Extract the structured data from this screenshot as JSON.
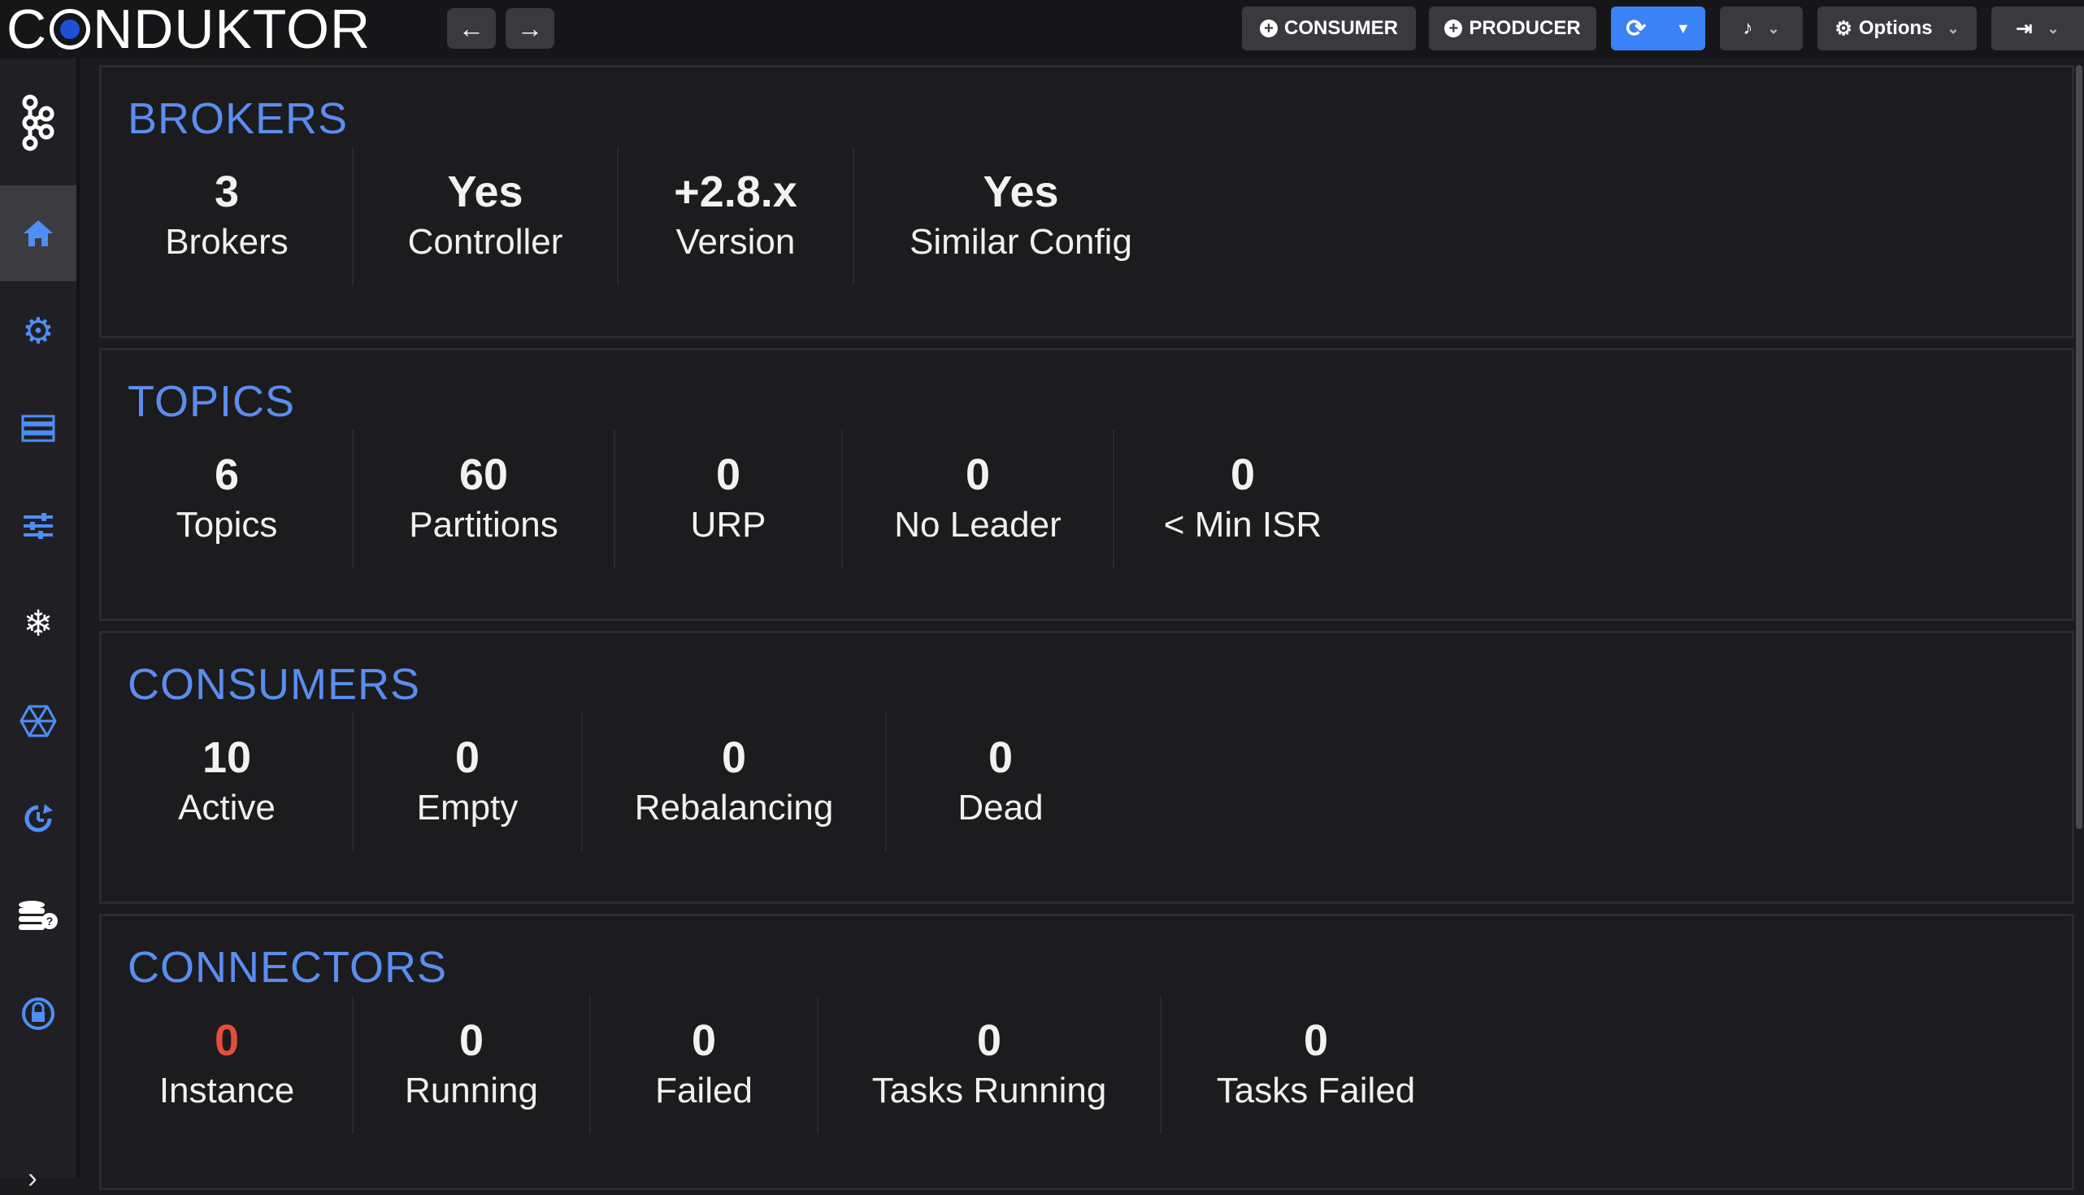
{
  "app": {
    "logo": "CONDUKTOR"
  },
  "toolbar": {
    "back_icon": "←",
    "forward_icon": "→",
    "consumer_label": "CONSUMER",
    "producer_label": "PRODUCER",
    "refresh_icon": "⟳",
    "refresh_dropdown_icon": "▼",
    "bell_icon": "🔔",
    "options_label": "Options",
    "logout_icon": "⇥",
    "chevron": "⌄"
  },
  "sidebar": {
    "items": [
      {
        "name": "cluster-icon",
        "glyph": "⚛"
      },
      {
        "name": "home-icon",
        "glyph": "⌂"
      },
      {
        "name": "brokers-config-icon",
        "glyph": "⚙"
      },
      {
        "name": "topics-icon",
        "glyph": "☰"
      },
      {
        "name": "settings-sliders-icon",
        "glyph": "≡"
      },
      {
        "name": "schema-help-icon",
        "glyph": "❄"
      },
      {
        "name": "connect-icon",
        "glyph": "⬡"
      },
      {
        "name": "history-icon",
        "glyph": "↻"
      },
      {
        "name": "database-help-icon",
        "glyph": "⛁"
      },
      {
        "name": "security-lock-icon",
        "glyph": "🔒"
      }
    ],
    "expand_icon": "›"
  },
  "panels": {
    "brokers": {
      "title": "BROKERS",
      "stats": [
        {
          "value": "3",
          "label": "Brokers"
        },
        {
          "value": "Yes",
          "label": "Controller"
        },
        {
          "value": "+2.8.x",
          "label": "Version"
        },
        {
          "value": "Yes",
          "label": "Similar Config"
        }
      ]
    },
    "topics": {
      "title": "TOPICS",
      "stats": [
        {
          "value": "6",
          "label": "Topics"
        },
        {
          "value": "60",
          "label": "Partitions"
        },
        {
          "value": "0",
          "label": "URP"
        },
        {
          "value": "0",
          "label": "No Leader"
        },
        {
          "value": "0",
          "label": "< Min ISR"
        }
      ]
    },
    "consumers": {
      "title": "CONSUMERS",
      "stats": [
        {
          "value": "10",
          "label": "Active"
        },
        {
          "value": "0",
          "label": "Empty"
        },
        {
          "value": "0",
          "label": "Rebalancing"
        },
        {
          "value": "0",
          "label": "Dead"
        }
      ]
    },
    "connectors": {
      "title": "CONNECTORS",
      "stats": [
        {
          "value": "0",
          "label": "Instance"
        },
        {
          "value": "0",
          "label": "Running"
        },
        {
          "value": "0",
          "label": "Failed"
        },
        {
          "value": "0",
          "label": "Tasks Running"
        },
        {
          "value": "0",
          "label": "Tasks Failed"
        }
      ]
    }
  },
  "colors": {
    "accent": "#5b8def",
    "alert": "#e74c3c",
    "refresh_button": "#3b82f6"
  }
}
